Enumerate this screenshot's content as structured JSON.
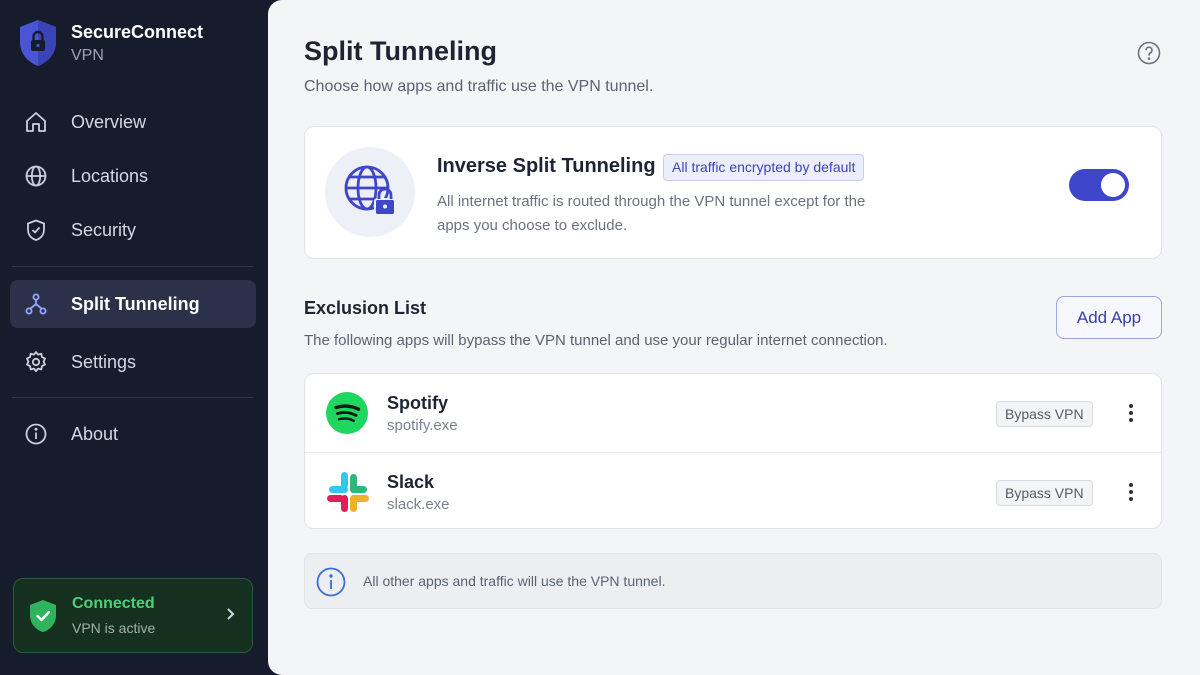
{
  "brand": {
    "name": "SecureConnect",
    "sub": "VPN"
  },
  "sidebar": {
    "items": [
      {
        "label": "Overview",
        "icon": "home-icon"
      },
      {
        "label": "Locations",
        "icon": "globe-icon"
      },
      {
        "label": "Security",
        "icon": "shield-check-icon"
      },
      {
        "label": "Split Tunneling",
        "icon": "split-tunnel-icon",
        "active": true
      },
      {
        "label": "Settings",
        "icon": "gear-icon"
      },
      {
        "label": "About",
        "icon": "info-icon"
      }
    ],
    "status": {
      "title": "Connected",
      "sub": "VPN is active"
    }
  },
  "main": {
    "title": "Split Tunneling",
    "subtitle": "Choose how apps and traffic use the VPN tunnel.",
    "feature": {
      "title": "Inverse Split Tunneling",
      "badge": "All traffic encrypted by default",
      "description": "All internet traffic is routed through the VPN tunnel except for the apps you choose to exclude.",
      "enabled": true
    },
    "exclusion": {
      "title": "Exclusion List",
      "subtitle": "The following apps will bypass the VPN tunnel and use your regular internet connection.",
      "add_label": "Add App",
      "apps": [
        {
          "name": "Spotify",
          "exe": "spotify.exe",
          "badge": "Bypass VPN",
          "icon": "spotify-icon"
        },
        {
          "name": "Slack",
          "exe": "slack.exe",
          "badge": "Bypass VPN",
          "icon": "slack-icon"
        }
      ]
    },
    "info": "All other apps and traffic will use the VPN tunnel."
  },
  "colors": {
    "accent": "#3e47c9",
    "sidebar_bg": "#161c2b",
    "connected": "#4ed07a",
    "spotify": "#1ed760"
  }
}
